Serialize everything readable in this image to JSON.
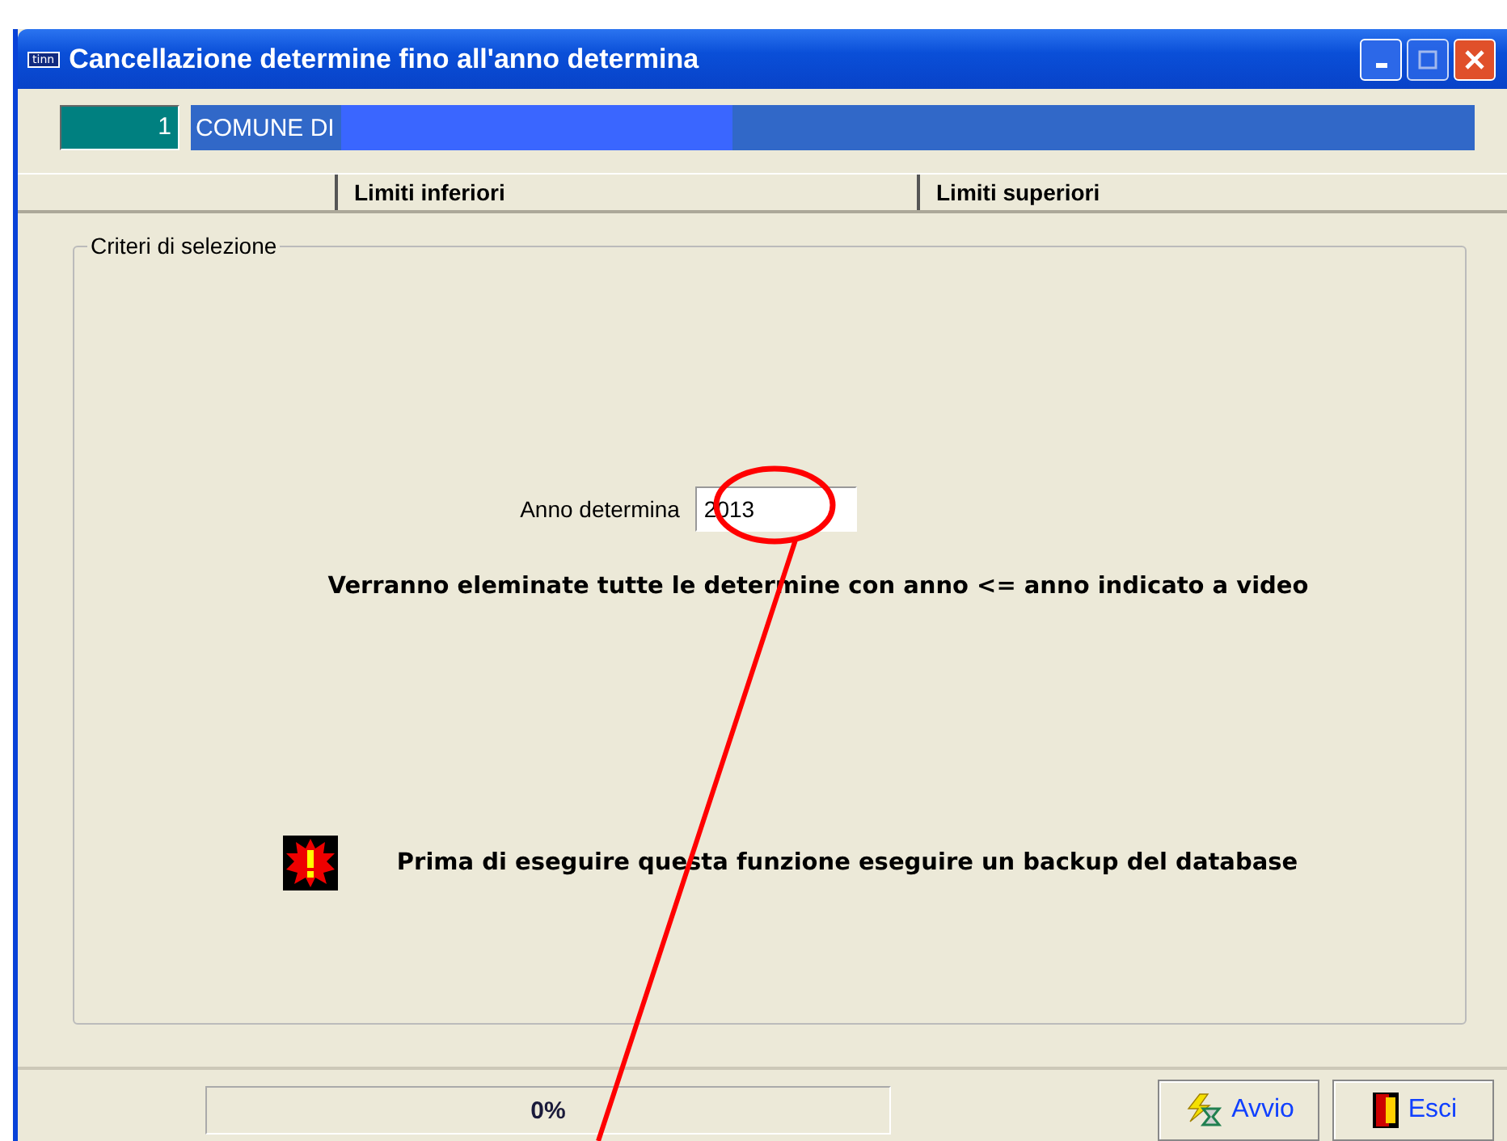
{
  "window": {
    "title": "Cancellazione determine fino all'anno determina",
    "app_badge": "tinn"
  },
  "entity": {
    "code": "1",
    "name": "COMUNE DI"
  },
  "columns": [
    "Limiti inferiori",
    "Limiti superiori"
  ],
  "group": {
    "title": "Criteri di selezione",
    "year_field": {
      "label": "Anno determina",
      "value": "2013"
    },
    "notice": "Verranno eleminate tutte le determine con anno <= anno indicato a video",
    "warning": "Prima di eseguire questa funzione eseguire un backup del database"
  },
  "progress": {
    "level": 0,
    "reading": "0%"
  },
  "buttons": [
    {
      "kind": "start",
      "label": "Avvio"
    },
    {
      "kind": "exit",
      "label": "Esci"
    }
  ]
}
